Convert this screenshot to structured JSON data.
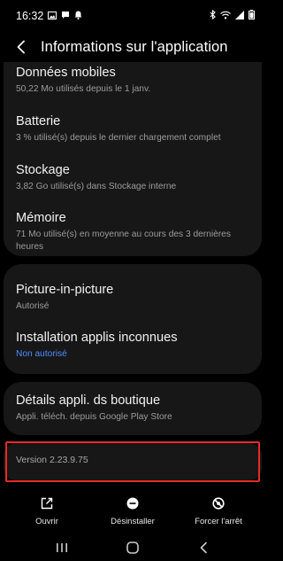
{
  "status_bar": {
    "time": "16:32",
    "icons": [
      "gallery-icon",
      "chat-icon",
      "notification-bell-icon",
      "bluetooth-icon",
      "wifi-icon",
      "signal-icon",
      "battery-icon"
    ]
  },
  "header": {
    "title": "Informations sur l'application",
    "back_icon": "back-arrow-icon"
  },
  "sections": {
    "usage": [
      {
        "title": "Données mobiles",
        "subtitle": "50,22 Mo utilisés depuis le 1 janv."
      },
      {
        "title": "Batterie",
        "subtitle": "3 % utilisé(s) depuis le dernier chargement complet"
      },
      {
        "title": "Stockage",
        "subtitle": "3,82 Go utilisé(s) dans Stockage interne"
      },
      {
        "title": "Mémoire",
        "subtitle_line1": "71 Mo utilisé(s) en moyenne au cours des 3 dernières",
        "subtitle_line2": "heures"
      }
    ],
    "permissions": [
      {
        "title": "Picture-in-picture",
        "subtitle": "Autorisé"
      },
      {
        "title": "Installation applis inconnues",
        "subtitle": "Non autorisé"
      }
    ],
    "store": {
      "title": "Détails appli. ds boutique",
      "subtitle": "Appli. téléch. depuis Google Play Store"
    },
    "version": "Version 2.23.9.75"
  },
  "actions": [
    {
      "label": "Ouvrir",
      "icon": "open-external-icon"
    },
    {
      "label": "Désinstaller",
      "icon": "uninstall-icon"
    },
    {
      "label": "Forcer l'arrêt",
      "icon": "force-stop-icon"
    }
  ],
  "nav": [
    "recent-apps-icon",
    "home-icon",
    "nav-back-icon"
  ],
  "colors": {
    "background": "#000000",
    "card": "#171717",
    "accent_blue": "#4d8dff",
    "highlight": "#e52b24"
  }
}
